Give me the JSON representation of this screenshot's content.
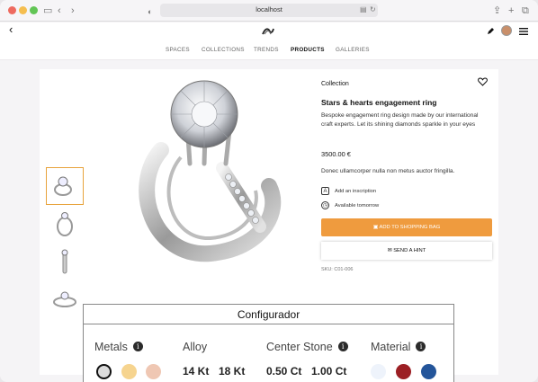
{
  "browser": {
    "url": "localhost",
    "icons": [
      "sidebar-icon",
      "chevron-left-icon",
      "chevron-right-icon",
      "shield-icon",
      "translate-icon",
      "reload-icon",
      "share-icon",
      "plus-icon",
      "tabs-icon"
    ]
  },
  "header": {
    "back_icon": "‹",
    "nav": [
      "SPACES",
      "COLLECTIONS",
      "TRENDS",
      "PRODUCTS",
      "GALLERIES"
    ],
    "active_nav": "PRODUCTS"
  },
  "product": {
    "collection": "Collection",
    "title": "Stars & hearts engagement ring",
    "description": "Bespoke engagement ring design made by our international craft experts. Let its shining diamonds sparkle in your eyes",
    "price": "3500.00 €",
    "lorem": "Donec ullamcorper nulla non metus auctor fringilla.",
    "features": [
      {
        "icon": "inscription-icon",
        "label": "Add an inscription"
      },
      {
        "icon": "clock-icon",
        "label": "Available tomorrow"
      }
    ],
    "add_to_bag": "ADD TO SHOPPING BAG",
    "send_hint": "SEND A HINT",
    "sku": "SKU: C01-006"
  },
  "configurator": {
    "title": "Configurador",
    "groups": [
      "Metals",
      "Alloy",
      "Center Stone",
      "Material"
    ],
    "metals": [
      "#dcdcdc",
      "#f6d48f",
      "#efc7b3"
    ],
    "alloy_options": [
      "14 Kt",
      "18 Kt"
    ],
    "stone_options": [
      "0.50 Ct",
      "1.00 Ct"
    ],
    "materials": [
      "#eef3fb",
      "#9c1f24",
      "#24559a"
    ]
  }
}
